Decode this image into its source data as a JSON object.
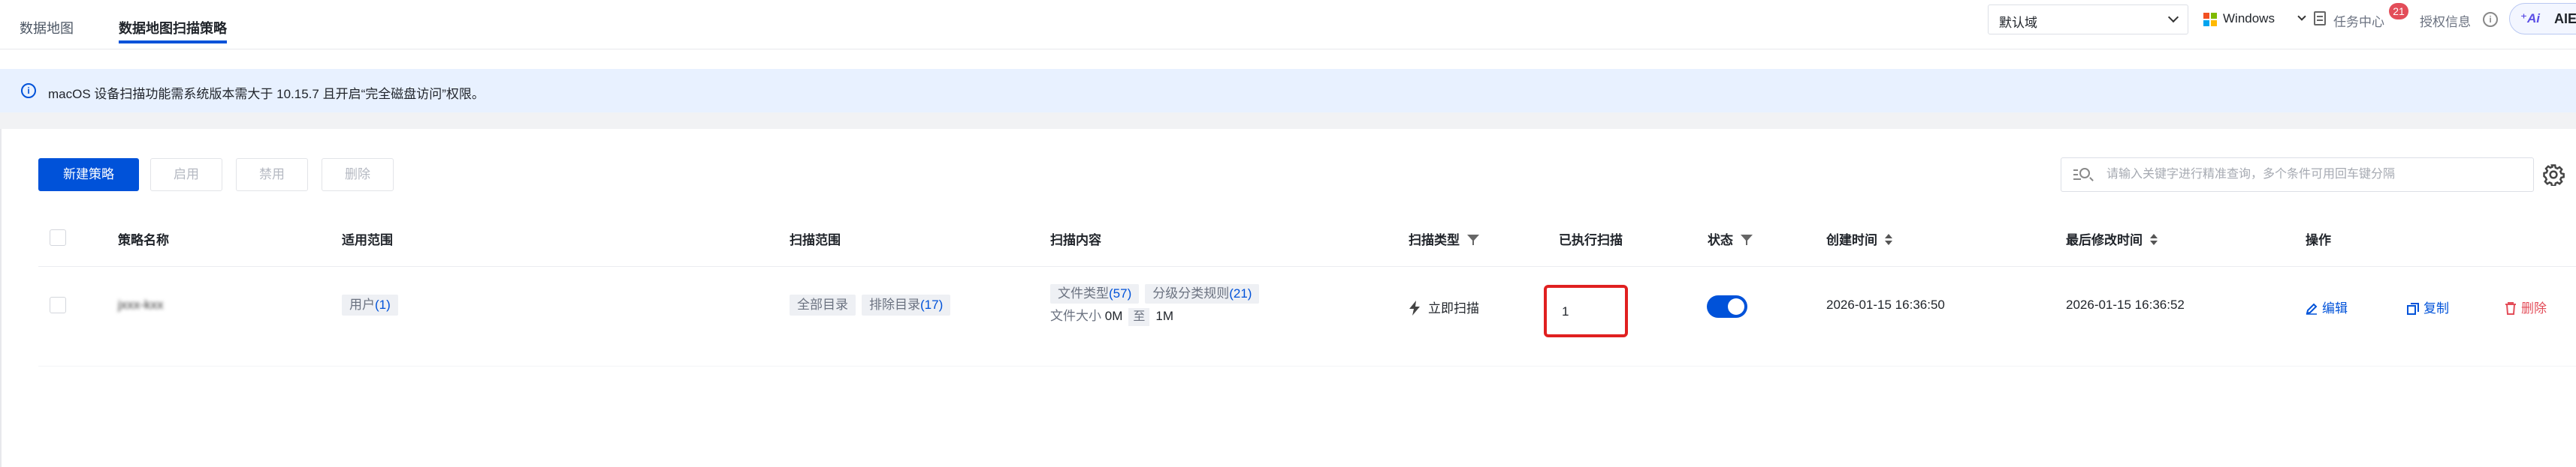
{
  "tabs": [
    {
      "label": "数据地图",
      "active": false
    },
    {
      "label": "数据地图扫描策略",
      "active": true
    }
  ],
  "header": {
    "domain_select": "默认域",
    "os_select": "Windows",
    "task_center": "任务中心",
    "task_badge": "21",
    "auth_info": "授权信息",
    "ai_label": "AIE"
  },
  "alert": {
    "message": "macOS 设备扫描功能需系统版本需大于 10.15.7 且开启“完全磁盘访问”权限。"
  },
  "toolbar": {
    "new_label": "新建策略",
    "enable_label": "启用",
    "disable_label": "禁用",
    "delete_label": "删除",
    "search_placeholder": "请输入关键字进行精准查询，多个条件可用回车键分隔"
  },
  "table": {
    "columns": {
      "name": "策略名称",
      "scope": "适用范围",
      "scan_range": "扫描范围",
      "scan_content": "扫描内容",
      "scan_type": "扫描类型",
      "executed": "已执行扫描",
      "status": "状态",
      "created": "创建时间",
      "modified": "最后修改时间",
      "ops": "操作"
    },
    "rows": [
      {
        "name": "jxxx-kxx",
        "scope_label": "用户",
        "scope_count": "(1)",
        "range_all": "全部目录",
        "range_exclude": "排除目录",
        "range_exclude_count": "(17)",
        "content_filetype": "文件类型",
        "content_filetype_count": "(57)",
        "content_rules": "分级分类规则",
        "content_rules_count": "(21)",
        "size_label": "文件大小",
        "size_min": "0M",
        "size_to": "至",
        "size_max": "1M",
        "scan_type": "立即扫描",
        "executed": "1",
        "status_on": true,
        "created": "2026-01-15 16:36:50",
        "modified": "2026-01-15 16:36:52",
        "op_edit": "编辑",
        "op_copy": "复制",
        "op_delete": "删除"
      }
    ]
  },
  "colors": {
    "primary": "#0052d9",
    "danger": "#e34d59",
    "alert_bg": "#e8f1ff"
  }
}
